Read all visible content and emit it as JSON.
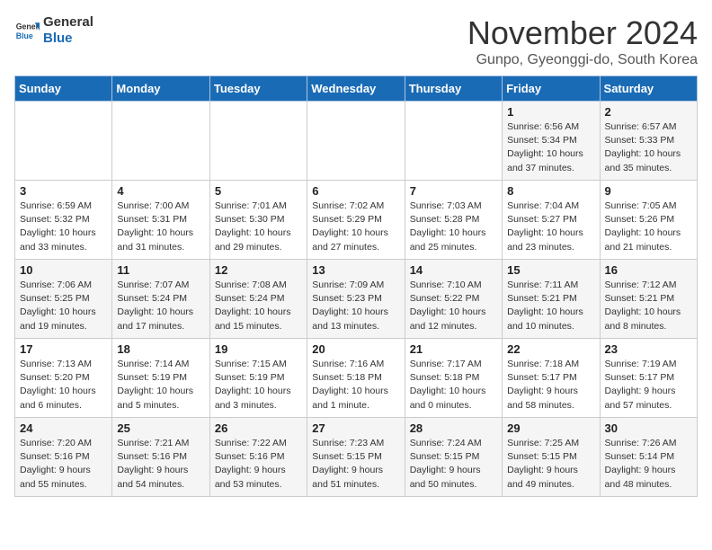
{
  "header": {
    "logo_general": "General",
    "logo_blue": "Blue",
    "month_title": "November 2024",
    "location": "Gunpo, Gyeonggi-do, South Korea"
  },
  "weekdays": [
    "Sunday",
    "Monday",
    "Tuesday",
    "Wednesday",
    "Thursday",
    "Friday",
    "Saturday"
  ],
  "weeks": [
    [
      {
        "day": "",
        "info": ""
      },
      {
        "day": "",
        "info": ""
      },
      {
        "day": "",
        "info": ""
      },
      {
        "day": "",
        "info": ""
      },
      {
        "day": "",
        "info": ""
      },
      {
        "day": "1",
        "info": "Sunrise: 6:56 AM\nSunset: 5:34 PM\nDaylight: 10 hours and 37 minutes."
      },
      {
        "day": "2",
        "info": "Sunrise: 6:57 AM\nSunset: 5:33 PM\nDaylight: 10 hours and 35 minutes."
      }
    ],
    [
      {
        "day": "3",
        "info": "Sunrise: 6:59 AM\nSunset: 5:32 PM\nDaylight: 10 hours and 33 minutes."
      },
      {
        "day": "4",
        "info": "Sunrise: 7:00 AM\nSunset: 5:31 PM\nDaylight: 10 hours and 31 minutes."
      },
      {
        "day": "5",
        "info": "Sunrise: 7:01 AM\nSunset: 5:30 PM\nDaylight: 10 hours and 29 minutes."
      },
      {
        "day": "6",
        "info": "Sunrise: 7:02 AM\nSunset: 5:29 PM\nDaylight: 10 hours and 27 minutes."
      },
      {
        "day": "7",
        "info": "Sunrise: 7:03 AM\nSunset: 5:28 PM\nDaylight: 10 hours and 25 minutes."
      },
      {
        "day": "8",
        "info": "Sunrise: 7:04 AM\nSunset: 5:27 PM\nDaylight: 10 hours and 23 minutes."
      },
      {
        "day": "9",
        "info": "Sunrise: 7:05 AM\nSunset: 5:26 PM\nDaylight: 10 hours and 21 minutes."
      }
    ],
    [
      {
        "day": "10",
        "info": "Sunrise: 7:06 AM\nSunset: 5:25 PM\nDaylight: 10 hours and 19 minutes."
      },
      {
        "day": "11",
        "info": "Sunrise: 7:07 AM\nSunset: 5:24 PM\nDaylight: 10 hours and 17 minutes."
      },
      {
        "day": "12",
        "info": "Sunrise: 7:08 AM\nSunset: 5:24 PM\nDaylight: 10 hours and 15 minutes."
      },
      {
        "day": "13",
        "info": "Sunrise: 7:09 AM\nSunset: 5:23 PM\nDaylight: 10 hours and 13 minutes."
      },
      {
        "day": "14",
        "info": "Sunrise: 7:10 AM\nSunset: 5:22 PM\nDaylight: 10 hours and 12 minutes."
      },
      {
        "day": "15",
        "info": "Sunrise: 7:11 AM\nSunset: 5:21 PM\nDaylight: 10 hours and 10 minutes."
      },
      {
        "day": "16",
        "info": "Sunrise: 7:12 AM\nSunset: 5:21 PM\nDaylight: 10 hours and 8 minutes."
      }
    ],
    [
      {
        "day": "17",
        "info": "Sunrise: 7:13 AM\nSunset: 5:20 PM\nDaylight: 10 hours and 6 minutes."
      },
      {
        "day": "18",
        "info": "Sunrise: 7:14 AM\nSunset: 5:19 PM\nDaylight: 10 hours and 5 minutes."
      },
      {
        "day": "19",
        "info": "Sunrise: 7:15 AM\nSunset: 5:19 PM\nDaylight: 10 hours and 3 minutes."
      },
      {
        "day": "20",
        "info": "Sunrise: 7:16 AM\nSunset: 5:18 PM\nDaylight: 10 hours and 1 minute."
      },
      {
        "day": "21",
        "info": "Sunrise: 7:17 AM\nSunset: 5:18 PM\nDaylight: 10 hours and 0 minutes."
      },
      {
        "day": "22",
        "info": "Sunrise: 7:18 AM\nSunset: 5:17 PM\nDaylight: 9 hours and 58 minutes."
      },
      {
        "day": "23",
        "info": "Sunrise: 7:19 AM\nSunset: 5:17 PM\nDaylight: 9 hours and 57 minutes."
      }
    ],
    [
      {
        "day": "24",
        "info": "Sunrise: 7:20 AM\nSunset: 5:16 PM\nDaylight: 9 hours and 55 minutes."
      },
      {
        "day": "25",
        "info": "Sunrise: 7:21 AM\nSunset: 5:16 PM\nDaylight: 9 hours and 54 minutes."
      },
      {
        "day": "26",
        "info": "Sunrise: 7:22 AM\nSunset: 5:16 PM\nDaylight: 9 hours and 53 minutes."
      },
      {
        "day": "27",
        "info": "Sunrise: 7:23 AM\nSunset: 5:15 PM\nDaylight: 9 hours and 51 minutes."
      },
      {
        "day": "28",
        "info": "Sunrise: 7:24 AM\nSunset: 5:15 PM\nDaylight: 9 hours and 50 minutes."
      },
      {
        "day": "29",
        "info": "Sunrise: 7:25 AM\nSunset: 5:15 PM\nDaylight: 9 hours and 49 minutes."
      },
      {
        "day": "30",
        "info": "Sunrise: 7:26 AM\nSunset: 5:14 PM\nDaylight: 9 hours and 48 minutes."
      }
    ]
  ]
}
